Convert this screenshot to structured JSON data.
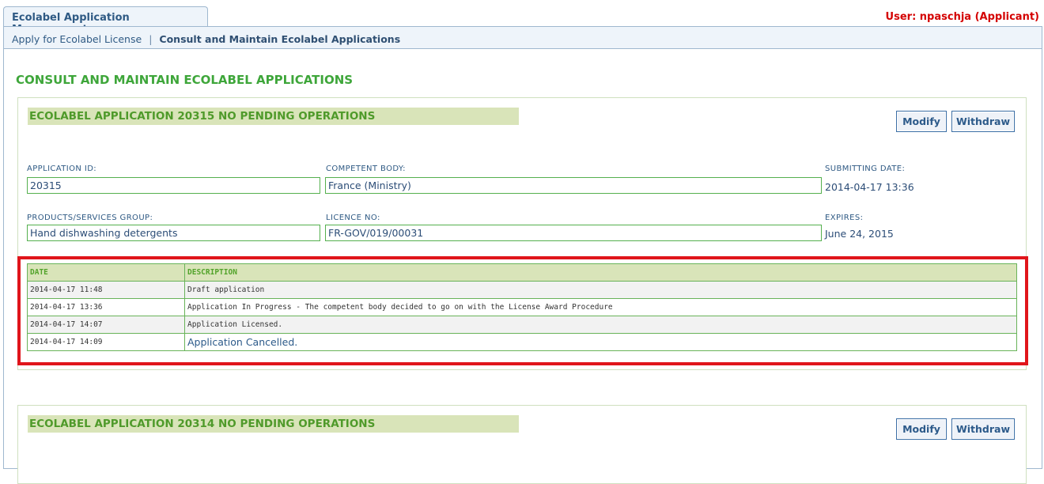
{
  "header": {
    "tab_label": "Ecolabel Application Management",
    "user_label": "User: npaschja (Applicant)"
  },
  "subnav": {
    "apply_link": "Apply for Ecolabel License",
    "separator": "|",
    "consult_link": "Consult and Maintain Ecolabel Applications"
  },
  "page_title": "CONSULT AND MAINTAIN ECOLABEL APPLICATIONS",
  "applications": [
    {
      "heading": "ECOLABEL APPLICATION 20315 NO PENDING OPERATIONS",
      "modify_label": "Modify",
      "withdraw_label": "Withdraw",
      "fields": {
        "application_id_label": "APPLICATION ID:",
        "application_id": "20315",
        "competent_body_label": "COMPETENT BODY:",
        "competent_body": "France (Ministry)",
        "submitting_date_label": "SUBMITTING DATE:",
        "submitting_date": "2014-04-17 13:36",
        "group_label": "PRODUCTS/SERVICES GROUP:",
        "group": "Hand dishwashing detergents",
        "licence_label": "LICENCE NO:",
        "licence": "FR-GOV/019/00031",
        "expires_label": "EXPIRES:",
        "expires": "June 24, 2015"
      },
      "history": {
        "col_date": "DATE",
        "col_description": "DESCRIPTION",
        "rows": [
          {
            "date": "2014-04-17 11:48",
            "description": "Draft application"
          },
          {
            "date": "2014-04-17 13:36",
            "description": "Application In Progress - The competent body decided to go on with the License Award Procedure"
          },
          {
            "date": "2014-04-17 14:07",
            "description": "Application Licensed."
          },
          {
            "date": "2014-04-17 14:09",
            "description": "Application Cancelled."
          }
        ]
      }
    },
    {
      "heading": "ECOLABEL APPLICATION 20314 NO PENDING OPERATIONS",
      "modify_label": "Modify",
      "withdraw_label": "Withdraw"
    }
  ],
  "colors": {
    "accent_green": "#3ea63a",
    "header_band": "#d9e4b9",
    "highlight_red": "#e0151b",
    "user_red": "#d40000"
  }
}
